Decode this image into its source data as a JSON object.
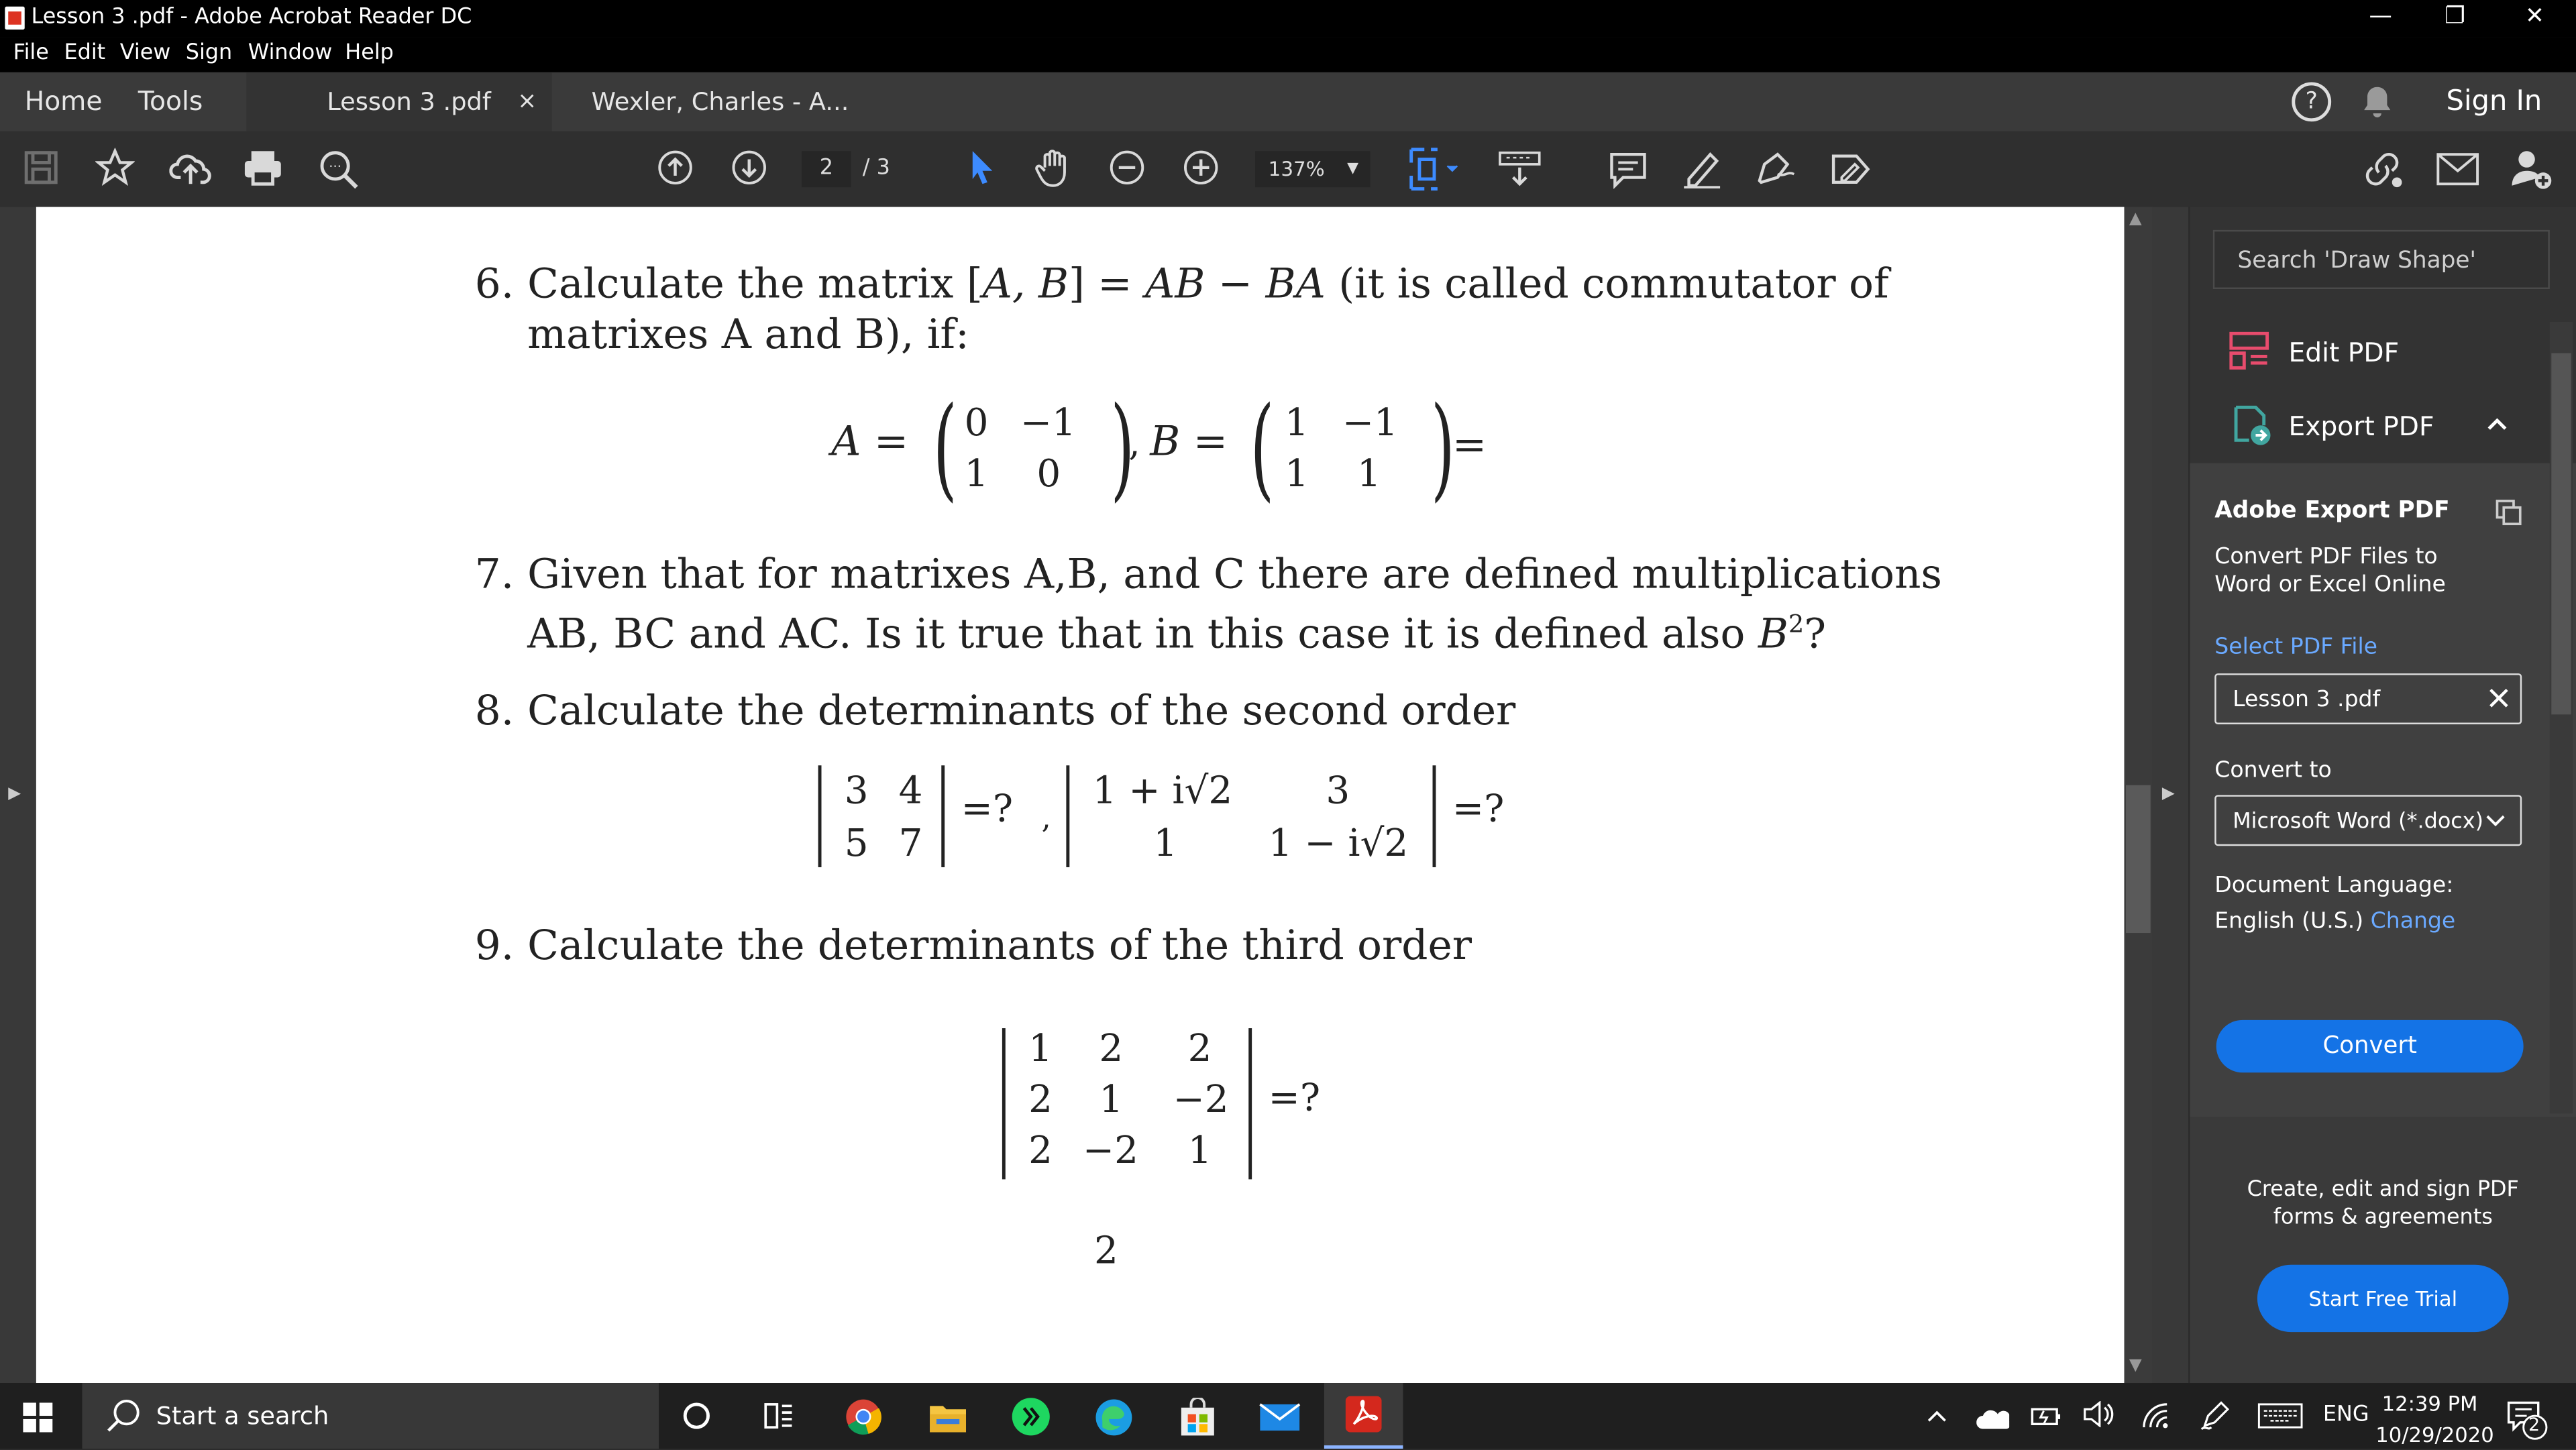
{
  "window": {
    "title": "Lesson 3 .pdf - Adobe Acrobat Reader DC",
    "controls": {
      "minimize": "—",
      "restore": "❐",
      "close": "✕"
    }
  },
  "menu": [
    "File",
    "Edit",
    "View",
    "Sign",
    "Window",
    "Help"
  ],
  "tabs": {
    "home": "Home",
    "tools": "Tools",
    "doc1": "Lesson 3 .pdf",
    "doc1_close": "×",
    "doc2": "Wexler, Charles - A...",
    "help": "?",
    "sign_in": "Sign In"
  },
  "toolbar": {
    "page_current": "2",
    "page_total": "/ 3",
    "zoom": "137%"
  },
  "document": {
    "p6_num": "6.",
    "p6_line1a": "Calculate the matrix [",
    "p6_line1b": "A, B",
    "p6_line1c": "] = ",
    "p6_line1d": "AB",
    "p6_line1e": " − ",
    "p6_line1f": "BA",
    "p6_line1g": " (it is called commutator of",
    "p6_line2": "matrixes A and B), if:",
    "matA_label": "A",
    "matA": [
      "0",
      "−1",
      "1",
      "0"
    ],
    "matB_label": "B",
    "matB": [
      "1",
      "−1",
      "1",
      "1"
    ],
    "eq": "=",
    "comma": ",",
    "p7_num": "7.",
    "p7_line1": "Given that for matrixes A,B, and C there are defined multiplications",
    "p7_line2a": "AB, BC and AC. Is it true that in this case it is defined also ",
    "p7_line2b": "B",
    "p7_line2c": "2",
    "p7_line2d": "?",
    "p8_num": "8.",
    "p8_text": "Calculate the determinants of the second order",
    "det2a": [
      "3",
      "4",
      "5",
      "7"
    ],
    "det2b": [
      "1 + i√2",
      "3",
      "1",
      "1 − i√2"
    ],
    "q": "=?",
    "p9_num": "9.",
    "p9_text": "Calculate the determinants of the third order",
    "det3": [
      "1",
      "2",
      "2",
      "2",
      "1",
      "−2",
      "2",
      "−2",
      "1"
    ],
    "page_number": "2"
  },
  "right_panel": {
    "search_placeholder": "Search 'Draw Shape'",
    "edit_pdf": "Edit PDF",
    "export_pdf": "Export PDF",
    "export_title": "Adobe Export PDF",
    "export_desc": "Convert PDF Files to Word or Excel Online",
    "select_file": "Select PDF File",
    "file_name": "Lesson 3 .pdf",
    "convert_to": "Convert to",
    "format": "Microsoft Word (*.docx)",
    "doc_lang_label": "Document Language:",
    "doc_lang": "English (U.S.)",
    "change": "Change",
    "convert_btn": "Convert",
    "promo": "Create, edit and sign PDF forms & agreements",
    "trial_btn": "Start Free Trial"
  },
  "taskbar": {
    "search": "Start a search",
    "lang": "ENG",
    "time": "12:39 PM",
    "date": "10/29/2020",
    "notif_count": "2"
  },
  "colors": {
    "accent_blue": "#1473e6",
    "link_blue": "#6aa9ff",
    "acrobat_red": "#d4281d"
  }
}
